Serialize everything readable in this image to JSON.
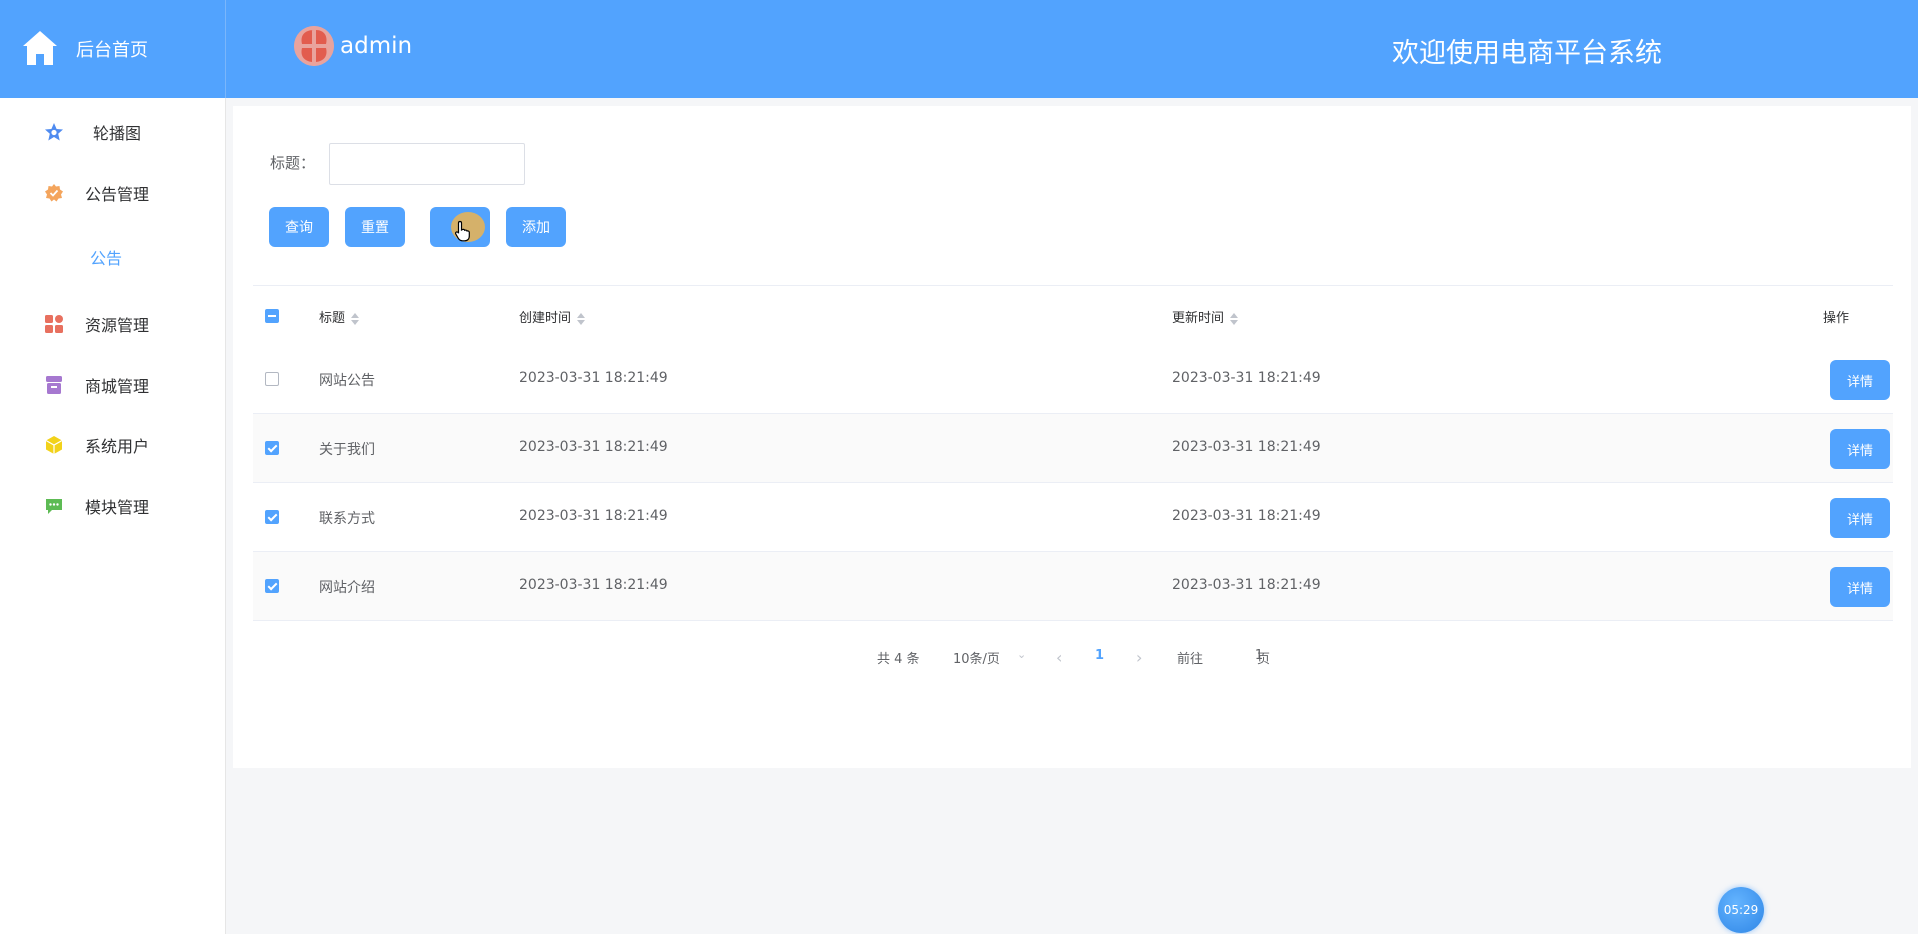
{
  "header": {
    "home_label": "后台首页",
    "user_name": "admin",
    "welcome": "欢迎使用电商平台系统",
    "bg_color": "#52a3fe"
  },
  "sidebar": {
    "items": [
      {
        "label": "轮播图",
        "icon": "star-icon",
        "color": "#4f8bf0"
      },
      {
        "label": "公告管理",
        "icon": "badge-icon",
        "color": "#f4a55d"
      },
      {
        "label": "资源管理",
        "icon": "grid-icon",
        "color": "#e8705f"
      },
      {
        "label": "商城管理",
        "icon": "box-icon",
        "color": "#a678d0"
      },
      {
        "label": "系统用户",
        "icon": "cube-icon",
        "color": "#f2d21a"
      },
      {
        "label": "模块管理",
        "icon": "chat-icon",
        "color": "#5dbb54"
      }
    ],
    "sub_item": "公告",
    "active_color": "#52a3fe"
  },
  "search": {
    "label": "标题：",
    "value": "",
    "placeholder": ""
  },
  "toolbar": {
    "query": "查询",
    "reset": "重置",
    "delete": "删除",
    "add": "添加"
  },
  "table": {
    "headers": {
      "title": "标题",
      "created": "创建时间",
      "updated": "更新时间",
      "action": "操作"
    },
    "rows": [
      {
        "title": "网站公告",
        "created": "2023-03-31 18:21:49",
        "updated": "2023-03-31 18:21:49",
        "checked": false,
        "action": "详情"
      },
      {
        "title": "关于我们",
        "created": "2023-03-31 18:21:49",
        "updated": "2023-03-31 18:21:49",
        "checked": true,
        "action": "详情"
      },
      {
        "title": "联系方式",
        "created": "2023-03-31 18:21:49",
        "updated": "2023-03-31 18:21:49",
        "checked": true,
        "action": "详情"
      },
      {
        "title": "网站介绍",
        "created": "2023-03-31 18:21:49",
        "updated": "2023-03-31 18:21:49",
        "checked": true,
        "action": "详情"
      }
    ],
    "select_all_state": "indeterminate"
  },
  "pagination": {
    "total": "共 4 条",
    "page_size": "10条/页",
    "current_page": "1",
    "goto_prefix": "前往",
    "goto_value": "1",
    "goto_suffix": "页"
  },
  "clock": "05:29"
}
